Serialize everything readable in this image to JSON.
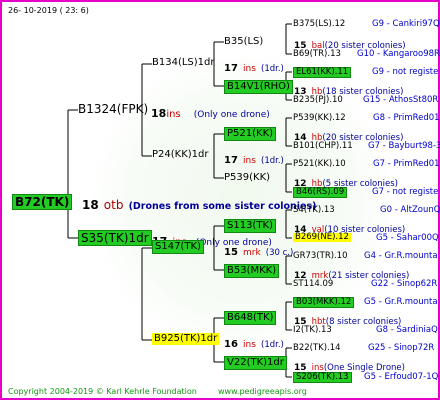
{
  "header": {
    "date": "26- 10-2019 ( 23: 6)"
  },
  "root": {
    "label": "B72(TK)",
    "num": "18",
    "ins": "otb",
    "note": "(Drones from some sister colonies)",
    "color": "#22cc22"
  },
  "father": {
    "label": "B1324(FPK)",
    "num": "18",
    "ins": "ins",
    "note": "(Only one drone)"
  },
  "mother": {
    "label": "S35(TK)1dr",
    "num": "17",
    "ins": "ins",
    "note": "(Only one drone)"
  },
  "ff": {
    "label": "B134(LS)1dr",
    "num": "17",
    "ins": "ins",
    "note": "(1dr.)"
  },
  "fm": {
    "label": "P24(KK)1dr",
    "num": "17",
    "ins": "ins",
    "note": "(1dr.)"
  },
  "mf": {
    "label": "S147(TK)",
    "num": "15",
    "ins": "mrk",
    "note": "(30 c.)"
  },
  "mm": {
    "label": "B925(TK)1dr",
    "num": "16",
    "ins": "ins",
    "note": "(1dr.)"
  },
  "g3": [
    {
      "label": "B35(LS)"
    },
    {
      "label": "B14V1(RHO)"
    },
    {
      "label": "P521(KK)"
    },
    {
      "label": "P539(KK)"
    },
    {
      "label": "S113(TK)"
    },
    {
      "label": "B53(MKK)"
    },
    {
      "label": "B648(TK)"
    },
    {
      "label": "V22(TK)1dr"
    }
  ],
  "g3notes": [
    {
      "num": "15",
      "ins": "bal",
      "note": "(20 sister colonies)"
    },
    {
      "num": "13",
      "ins": "hb",
      "note": "(18 sister colonies)"
    },
    {
      "num": "14",
      "ins": "hb",
      "note": "(20 sister colonies)"
    },
    {
      "num": "12",
      "ins": "hb",
      "note": "(5 sister colonies)"
    },
    {
      "num": "14",
      "ins": "val",
      "note": "(10 sister colonies)"
    },
    {
      "num": "12",
      "ins": "mrk",
      "note": "(21 sister colonies)"
    },
    {
      "num": "15",
      "ins": "hbt",
      "note": "(8 sister colonies)"
    },
    {
      "num": "15",
      "ins": "ins",
      "note": "(One Single Drone)"
    }
  ],
  "g4": [
    {
      "label": "B375(LS).12",
      "code": "G9 - Cankiri97Q"
    },
    {
      "label": "B69(TR).13",
      "code": "G10 - Kangaroo98R"
    },
    {
      "label": "EL61(KK).11",
      "code": "G9 - not registe"
    },
    {
      "label": "B235(PJ).10",
      "code": "G15 - AthosSt80R"
    },
    {
      "label": "P539(KK).12",
      "code": "G8 - PrimRed01"
    },
    {
      "label": "B101(CHP).11",
      "code": "G7 - Bayburt98-3"
    },
    {
      "label": "P521(KK).10",
      "code": "G7 - PrimRed01"
    },
    {
      "label": "B46(RS).09",
      "code": "G7 - not registe"
    },
    {
      "label": "S4(TK).13",
      "code": "G0 - AltZounQ"
    },
    {
      "label": "B269(NE).12",
      "code": "G5 - Sahar00Q"
    },
    {
      "label": "GR73(TR).10",
      "code": "G4 - Gr.R.mounta"
    },
    {
      "label": "ST114.09",
      "code": "G22 - Sinop62R"
    },
    {
      "label": "B03(MKK).12",
      "code": "G5 - Gr.R.mounta"
    },
    {
      "label": "I2(TK).13",
      "code": "G8 - SardiniaQ"
    },
    {
      "label": "B22(TK).14",
      "code": "G25 - Sinop72R"
    },
    {
      "label": "S206(TK).13",
      "code": "G5 - Erfoud07-1Q"
    }
  ],
  "footer": {
    "copyright": "Copyright 2004-2019 © Karl Kehrle Foundation",
    "url": "www.pedigreeapis.org"
  }
}
